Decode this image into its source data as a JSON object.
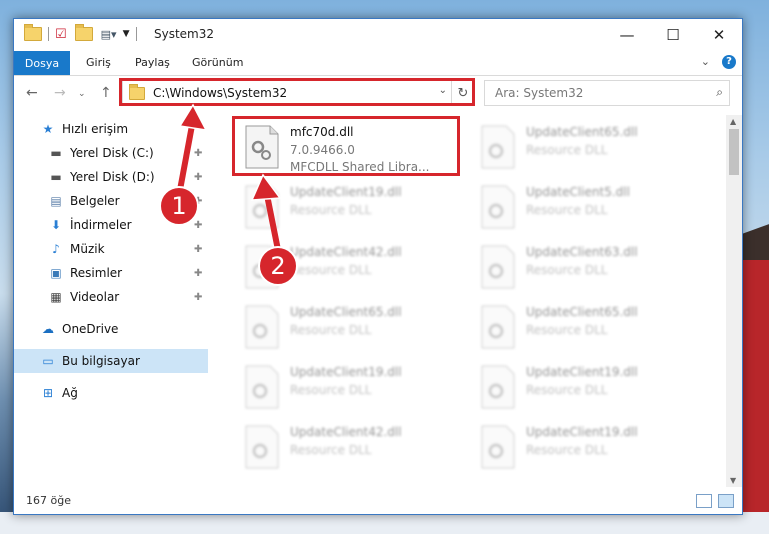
{
  "window": {
    "title": "System32",
    "tabs": [
      "Dosya",
      "Giriş",
      "Paylaş",
      "Görünüm"
    ],
    "controls": {
      "minimize": "—",
      "maximize": "☐",
      "close": "✕"
    }
  },
  "navbar": {
    "address": "C:\\Windows\\System32",
    "search_placeholder": "Ara: System32"
  },
  "sidebar": {
    "items": [
      {
        "label": "Hızlı erişim",
        "icon": "star-icon"
      },
      {
        "label": "Yerel Disk (C:)",
        "icon": "drive-icon",
        "pinned": true
      },
      {
        "label": "Yerel Disk (D:)",
        "icon": "drive-icon",
        "pinned": true
      },
      {
        "label": "Belgeler",
        "icon": "documents-icon",
        "pinned": true
      },
      {
        "label": "İndirmeler",
        "icon": "download-icon",
        "pinned": true
      },
      {
        "label": "Müzik",
        "icon": "music-icon",
        "pinned": true
      },
      {
        "label": "Resimler",
        "icon": "pictures-icon",
        "pinned": true
      },
      {
        "label": "Videolar",
        "icon": "videos-icon",
        "pinned": true
      },
      {
        "label": "OneDrive",
        "icon": "cloud-icon"
      },
      {
        "label": "Bu bilgisayar",
        "icon": "computer-icon",
        "selected": true
      },
      {
        "label": "Ağ",
        "icon": "network-icon"
      }
    ]
  },
  "files": {
    "highlighted": {
      "name": "mfc70d.dll",
      "version": "7.0.9466.0",
      "description": "MFCDLL Shared Libra..."
    },
    "col1": [
      {
        "name": "UpdateClient19.dll",
        "desc": "Resource DLL"
      },
      {
        "name": "UpdateClient42.dll",
        "desc": "Resource DLL"
      },
      {
        "name": "UpdateClient65.dll",
        "desc": "Resource DLL"
      },
      {
        "name": "UpdateClient19.dll",
        "desc": "Resource DLL"
      },
      {
        "name": "UpdateClient42.dll",
        "desc": "Resource DLL"
      }
    ],
    "col2": [
      {
        "name": "UpdateClient65.dll",
        "desc": "Resource DLL"
      },
      {
        "name": "UpdateClient5.dll",
        "desc": "Resource DLL"
      },
      {
        "name": "UpdateClient63.dll",
        "desc": "Resource DLL"
      },
      {
        "name": "UpdateClient65.dll",
        "desc": "Resource DLL"
      },
      {
        "name": "UpdateClient19.dll",
        "desc": "Resource DLL"
      },
      {
        "name": "UpdateClient19.dll",
        "desc": "Resource DLL"
      }
    ]
  },
  "status": {
    "count": "167 öğe"
  },
  "annotations": {
    "step1": "1",
    "step2": "2",
    "color": "#d6262c"
  }
}
